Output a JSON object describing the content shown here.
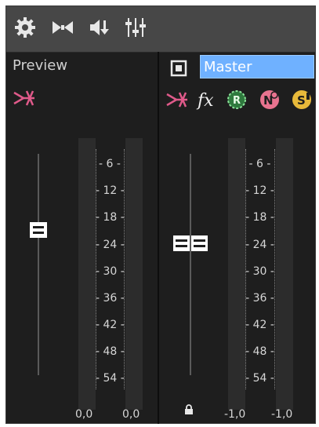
{
  "toolbar": {
    "icons": [
      "gear-icon",
      "bowtie-icon",
      "speaker-down-icon",
      "mixer-sliders-icon"
    ]
  },
  "preview": {
    "label": "Preview",
    "bottom_left": "0,0",
    "bottom_right": "0,0"
  },
  "master": {
    "label": "Master",
    "bottom_left": "-1,0",
    "bottom_right": "-1,0"
  },
  "scale": [
    "6",
    "12",
    "18",
    "24",
    "30",
    "36",
    "42",
    "48",
    "54"
  ],
  "colors": {
    "panel": "#1e1e1e",
    "toolbar": "#474747",
    "accent_pink": "#e05a8a",
    "master_field": "#6fb1ff",
    "green_fx": "#57c26a",
    "yellow_fx": "#e8b93a"
  }
}
